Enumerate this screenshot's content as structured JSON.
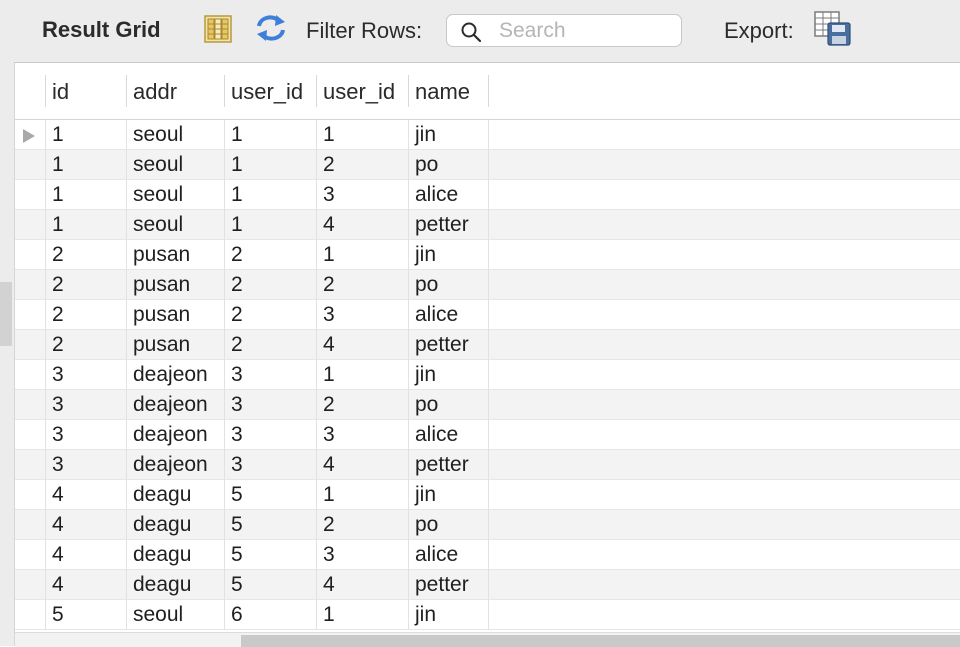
{
  "toolbar": {
    "title": "Result Grid",
    "filter_label": "Filter Rows:",
    "search_placeholder": "Search",
    "export_label": "Export:"
  },
  "grid": {
    "columns": [
      "id",
      "addr",
      "user_id",
      "user_id",
      "name"
    ],
    "rows": [
      [
        "1",
        "seoul",
        "1",
        "1",
        "jin"
      ],
      [
        "1",
        "seoul",
        "1",
        "2",
        "po"
      ],
      [
        "1",
        "seoul",
        "1",
        "3",
        "alice"
      ],
      [
        "1",
        "seoul",
        "1",
        "4",
        "petter"
      ],
      [
        "2",
        "pusan",
        "2",
        "1",
        "jin"
      ],
      [
        "2",
        "pusan",
        "2",
        "2",
        "po"
      ],
      [
        "2",
        "pusan",
        "2",
        "3",
        "alice"
      ],
      [
        "2",
        "pusan",
        "2",
        "4",
        "petter"
      ],
      [
        "3",
        "deajeon",
        "3",
        "1",
        "jin"
      ],
      [
        "3",
        "deajeon",
        "3",
        "2",
        "po"
      ],
      [
        "3",
        "deajeon",
        "3",
        "3",
        "alice"
      ],
      [
        "3",
        "deajeon",
        "3",
        "4",
        "petter"
      ],
      [
        "4",
        "deagu",
        "5",
        "1",
        "jin"
      ],
      [
        "4",
        "deagu",
        "5",
        "2",
        "po"
      ],
      [
        "4",
        "deagu",
        "5",
        "3",
        "alice"
      ],
      [
        "4",
        "deagu",
        "5",
        "4",
        "petter"
      ],
      [
        "5",
        "seoul",
        "6",
        "1",
        "jin"
      ]
    ],
    "selected_row": 0
  },
  "icons": {
    "columns_toggle": "columns-icon",
    "refresh": "refresh-icon",
    "search": "search-icon",
    "export": "export-icon"
  },
  "colors": {
    "toolbar_bg": "#ececec",
    "refresh_blue": "#3d7fd9",
    "columns_yellow": "#e8c766"
  }
}
